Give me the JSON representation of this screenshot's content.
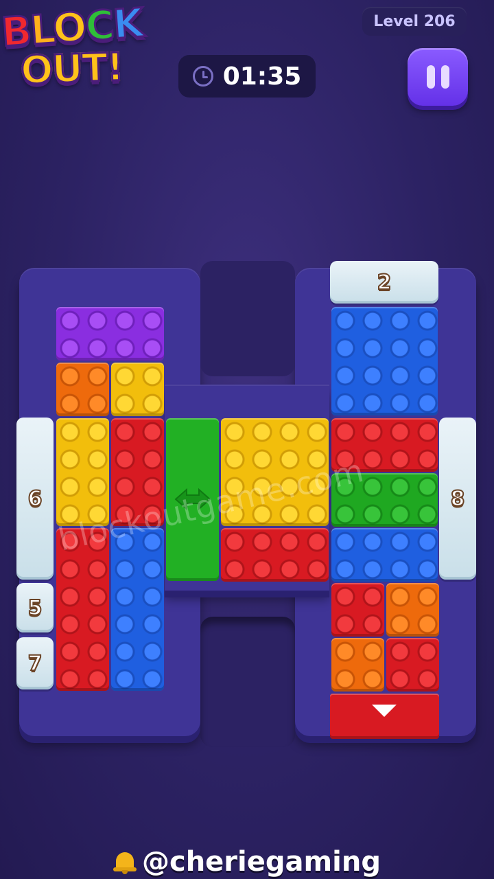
{
  "logo": {
    "line1": [
      "B",
      "L",
      "O",
      "C",
      "K"
    ],
    "line2": "OUT!"
  },
  "hud": {
    "level_label": "Level 206",
    "timer": "01:35"
  },
  "ice_counters": {
    "top_exit": "2",
    "left_upper": "6",
    "left_mid": "5",
    "left_low": "7",
    "right": "8"
  },
  "watermark": "blockoutgame.com",
  "credit": "@cheriegaming",
  "colors": {
    "background": "#2c2263",
    "frame": "#3f3496",
    "blue": "#1f5fe0",
    "red": "#d81a22",
    "yellow": "#f2be0c",
    "green": "#1fa821",
    "orange": "#ee6a0c",
    "purple": "#8a2ee0"
  },
  "icons": [
    "clock-icon",
    "pause-icon",
    "double-arrow-icon",
    "down-arrow-icon",
    "bell-icon"
  ]
}
